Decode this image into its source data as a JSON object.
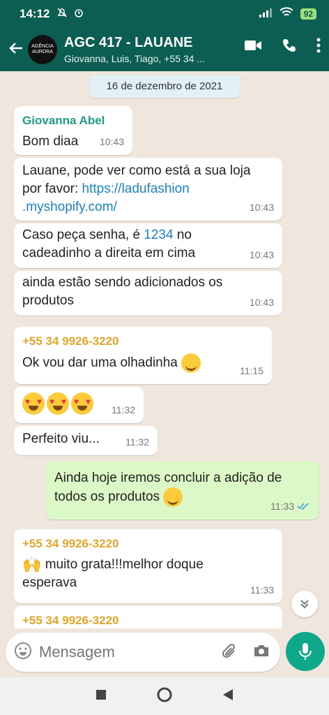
{
  "status": {
    "time": "14:12",
    "battery": "92"
  },
  "header": {
    "title": "AGC 417 - LAUANE",
    "subtitle": "Giovanna, Luis, Tiago, +55 34 ...",
    "avatar_text": "AGÊNCIA AURORA"
  },
  "chat": {
    "date": "16 de dezembro de 2021",
    "messages": [
      {
        "sender": "Giovanna Abel",
        "text": "Bom diaa",
        "time": "10:43"
      },
      {
        "text_prefix": "Lauane, pode ver como está a sua loja por favor: ",
        "link": "https://ladufashion.myshopify.com/",
        "link_line1": "https://ladufashion",
        "link_line2": ".myshopify.com/",
        "time": "10:43"
      },
      {
        "text_prefix": "Caso peça senha, é ",
        "highlight": "1234",
        "text_suffix": " no cadeadinho a direita em cima",
        "time": "10:43"
      },
      {
        "text": "ainda estão sendo adicionados os produtos",
        "time": "10:43"
      },
      {
        "sender": "+55 34 9926-3220",
        "text": "Ok vou dar uma olhadinha",
        "emoji": "grinning-face",
        "time": "11:15"
      },
      {
        "emoji": "heart-eyes-x3",
        "time": "11:32"
      },
      {
        "text": "Perfeito viu...",
        "time": "11:32"
      },
      {
        "text": "Ainda hoje iremos concluir a adição de todos os produtos",
        "emoji": "smiling-face",
        "time": "11:33",
        "outgoing": true,
        "ticks": "read"
      },
      {
        "sender": "+55 34 9926-3220",
        "text": "muito grata!!!melhor doque esperava",
        "emoji": "raising-hands",
        "time": "11:33"
      },
      {
        "sender": "+55 34 9926-3220"
      }
    ]
  },
  "input": {
    "placeholder": "Mensagem"
  },
  "colors": {
    "header": "#0c5d52",
    "accent": "#0fa88a",
    "outgoing_bubble": "#dcf8c6"
  }
}
